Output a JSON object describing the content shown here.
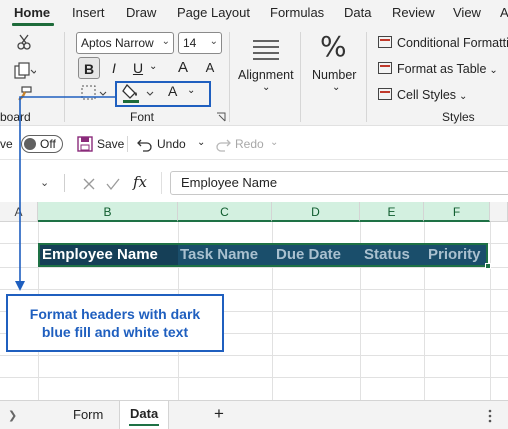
{
  "tabs": [
    "Home",
    "Insert",
    "Draw",
    "Page Layout",
    "Formulas",
    "Data",
    "Review",
    "View",
    "A"
  ],
  "ribbon": {
    "clipboard_label": "board",
    "font_name": "Aptos Narrow",
    "font_size": "14",
    "bold": "B",
    "italic": "I",
    "underline": "U",
    "grow_font": "A",
    "shrink_font": "A",
    "font_color_letter": "A",
    "font_group_label": "Font",
    "alignment_label": "Alignment",
    "number_label": "Number",
    "number_symbol": "%",
    "conditional_formatting": "Conditional Formatti",
    "format_as_table": "Format as Table",
    "cell_styles": "Cell Styles",
    "styles_group_label": "Styles",
    "accent_green": "#1e7145",
    "fill_color": "#1e6b3a"
  },
  "qat": {
    "autosave_fragment": "ve",
    "toggle_state": "Off",
    "save": "Save",
    "undo": "Undo",
    "redo": "Redo"
  },
  "formula_bar": {
    "fx": "fx",
    "value": "Employee Name"
  },
  "grid": {
    "columns": [
      "A",
      "B",
      "C",
      "D",
      "E",
      "F"
    ],
    "header_row": [
      "Employee Name",
      "Task Name",
      "Due Date",
      "Status",
      "Priority"
    ],
    "header_fill": "#1a4e6b",
    "header_text_color": "#ffffff"
  },
  "annotation": {
    "line1": "Format headers with dark",
    "line2": "blue fill and white text",
    "color": "#1f5fbf"
  },
  "sheets": {
    "tabs": [
      "Form",
      "Data"
    ],
    "active": "Data",
    "add": "+"
  }
}
